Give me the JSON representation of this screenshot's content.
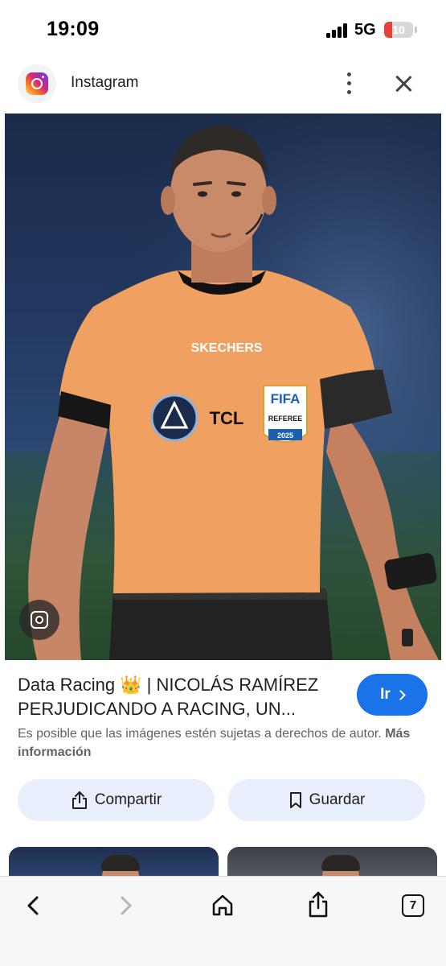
{
  "status_bar": {
    "time": "19:09",
    "network": "5G",
    "battery": "10",
    "battery_color": "#e8403a"
  },
  "source": {
    "name": "Instagram",
    "icon": "instagram-logo"
  },
  "main_image": {
    "alt": "Árbitro con camiseta naranja",
    "jersey_brand": "SKECHERS",
    "sponsor": "TCL",
    "badge_top": "FIFA",
    "badge_middle": "REFEREE",
    "badge_year": "2025",
    "lens_icon": "google-lens-icon"
  },
  "result": {
    "title": "Data Racing 👑 | NICOLÁS RAMÍREZ PERJUDICANDO A RACING, UN...",
    "go_label": "Ir",
    "copyright_text": "Es posible que las imágenes estén sujetas a derechos de autor.",
    "more_info": "Más información"
  },
  "actions": {
    "share_label": "Compartir",
    "save_label": "Guardar"
  },
  "toolbar": {
    "tabs_count": "7"
  },
  "colors": {
    "accent": "#1a73e8",
    "action_bg": "#e8eefb",
    "jersey": "#f0a060"
  }
}
